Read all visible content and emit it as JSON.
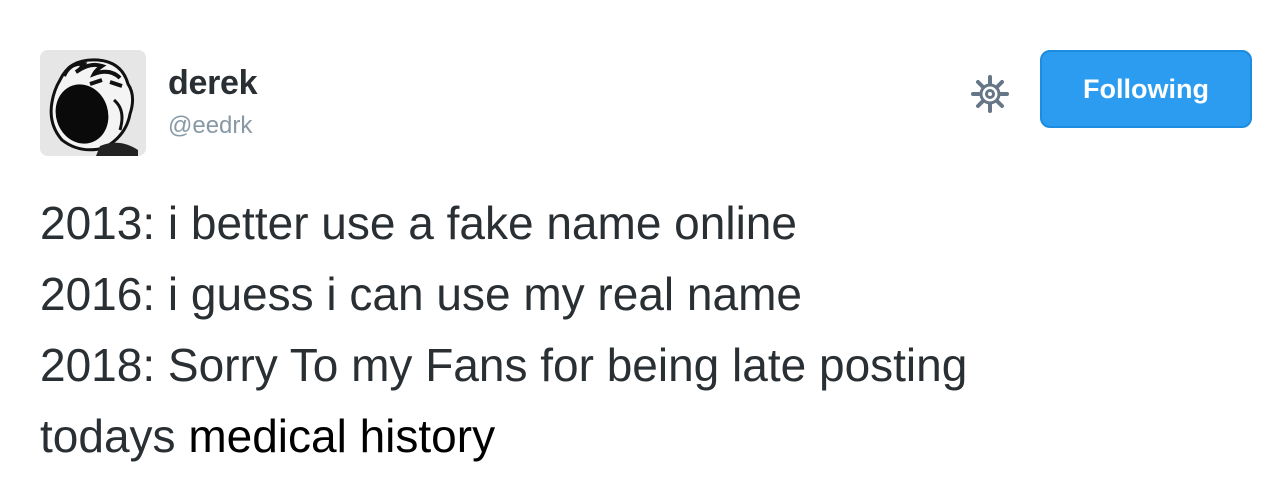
{
  "user": {
    "display_name": "derek",
    "handle": "@eedrk",
    "avatar_icon": "screaming-face-avatar"
  },
  "actions": {
    "settings_icon": "gear-icon",
    "follow_label": "Following",
    "follow_color": "#2b9cf0"
  },
  "tweet": {
    "lines": [
      "2013: i better use a fake name online",
      "2016: i guess i can use my real name",
      "2018: Sorry To my Fans for being late posting"
    ],
    "last_line_start": "todays",
    "last_line_end": "medical history"
  }
}
